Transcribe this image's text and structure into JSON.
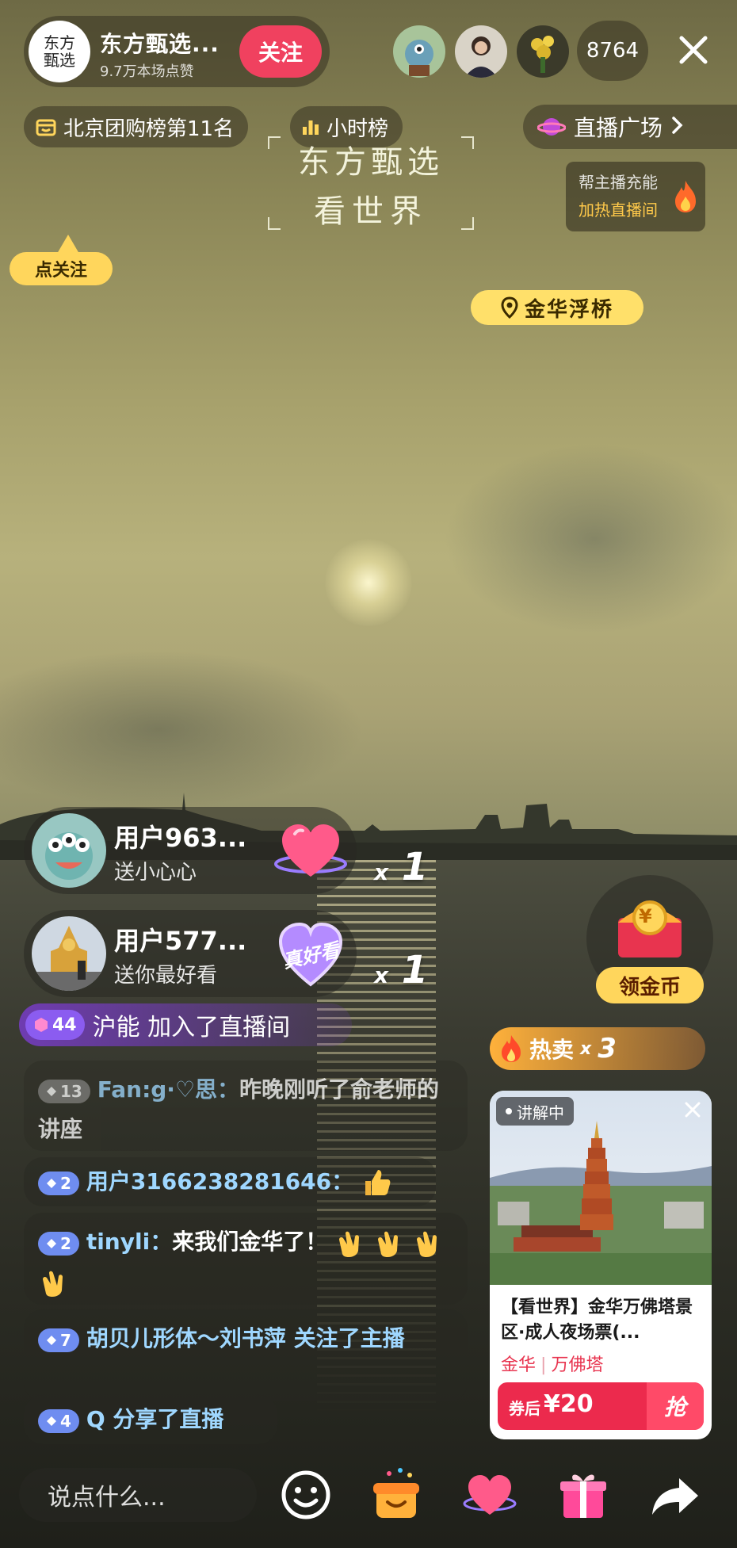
{
  "header": {
    "anchor_name": "东方甄选...",
    "anchor_logo_text_1": "东方",
    "anchor_logo_text_2": "甄选",
    "likes": "9.7万本场点赞",
    "follow_label": "关注",
    "viewer_count": "8764"
  },
  "badges": {
    "rank": "北京团购榜第11名",
    "hourly": "小时榜",
    "plaza": "直播广场"
  },
  "watermark": {
    "line1": "东方甄选",
    "line2": "看世界"
  },
  "recharge": {
    "line1": "帮主播充能",
    "line2": "加热直播间"
  },
  "follow_tip": "点关注",
  "location": "金华浮桥",
  "gifts": [
    {
      "user": "用户963...",
      "message": "送小心心",
      "combo_x": "x",
      "combo_n": "1"
    },
    {
      "user": "用户577...",
      "message": "送你最好看",
      "gift_text": "真好看",
      "combo_x": "x",
      "combo_n": "1"
    }
  ],
  "join_msg": {
    "level": "44",
    "text": "沪能 加入了直播间"
  },
  "chat": [
    {
      "level": "13",
      "user": "Fan:g·♡思：",
      "text": "昨晚刚听了俞老师的讲座"
    },
    {
      "level": "2",
      "user": "用户3166238281646：",
      "text": ""
    },
    {
      "level": "2",
      "user": "tinyli：",
      "text": "来我们金华了！"
    },
    {
      "level": "7",
      "user": "胡贝儿形体～刘书萍",
      "text": " 关注了主播"
    },
    {
      "level": "4",
      "user": "Q",
      "text": " 分享了直播"
    }
  ],
  "coin": {
    "label": "领金币",
    "symbol": "¥"
  },
  "hot_sale": {
    "label": "热卖",
    "x": "x",
    "n": "3"
  },
  "product": {
    "badge": "讲解中",
    "title": "【看世界】金华万佛塔景区·成人夜场票(...",
    "tag1": "金华",
    "tag2": "万佛塔",
    "price_label": "券后",
    "price": "¥20",
    "grab": "抢"
  },
  "bottom": {
    "input_placeholder": "说点什么..."
  },
  "colors": {
    "follow": "#f0415f",
    "accent_yellow": "#ffd65c",
    "price_red": "#ec2a4d",
    "chat_name": "#9fd7ff"
  }
}
